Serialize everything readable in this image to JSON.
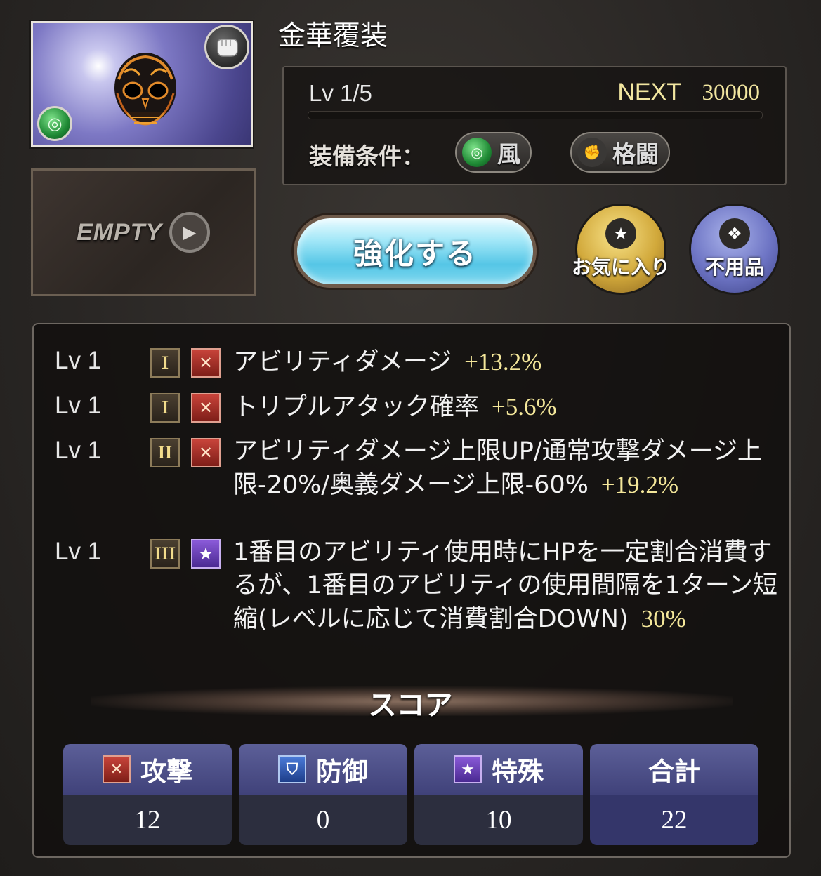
{
  "item": {
    "name": "金華覆装",
    "element_icon": "wind-element-icon",
    "weapon_icon": "fist-weapon-icon",
    "image": "golden-skull-mask"
  },
  "empty_slot": {
    "label": "EMPTY"
  },
  "level": {
    "current_label": "Lv 1/5",
    "next_label": "NEXT",
    "next_value": "30000",
    "progress": 0
  },
  "conditions": {
    "label": "装備条件：",
    "element": "風",
    "weapon_type": "格闘"
  },
  "buttons": {
    "upgrade": "強化する",
    "favorite": "お気に入り",
    "unneeded": "不用品"
  },
  "skills": [
    {
      "lv": "Lv 1",
      "tier": "I",
      "type": "attack",
      "text": "アビリティダメージ",
      "value": "+13.2%"
    },
    {
      "lv": "Lv 1",
      "tier": "I",
      "type": "attack",
      "text": "トリプルアタック確率",
      "value": "+5.6%"
    },
    {
      "lv": "Lv 1",
      "tier": "II",
      "type": "attack",
      "text": "アビリティダメージ上限UP/通常攻撃ダメージ上限-20%/奥義ダメージ上限-60%",
      "value": "+19.2%"
    },
    {
      "lv": "Lv 1",
      "tier": "III",
      "type": "special",
      "text": "1番目のアビリティ使用時にHPを一定割合消費するが、1番目のアビリティの使用間隔を1ターン短縮(レベルに応じて消費割合DOWN)",
      "value": "30%"
    }
  ],
  "score": {
    "title": "スコア",
    "attack": {
      "label": "攻撃",
      "value": "12"
    },
    "defense": {
      "label": "防御",
      "value": "0"
    },
    "special": {
      "label": "特殊",
      "value": "10"
    },
    "total": {
      "label": "合計",
      "value": "22"
    }
  },
  "colors": {
    "value_yellow": "#f4e79a",
    "score_header": "#4f5288",
    "upgrade_button": "#7fd8ef",
    "favorite_gold": "#d1a83a",
    "unneeded_purple": "#6d74c4"
  }
}
